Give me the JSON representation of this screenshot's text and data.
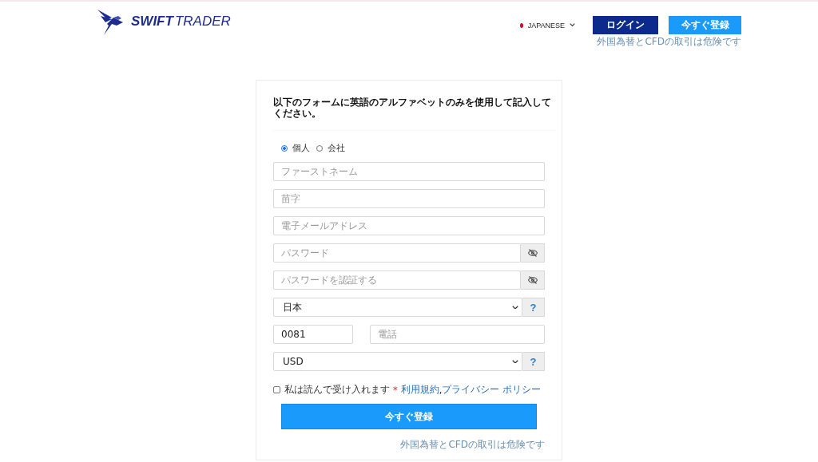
{
  "logo": {
    "word1": "SWIFT",
    "word2": "TRADER"
  },
  "header": {
    "language": "JAPANESE",
    "login": "ログイン",
    "register": "今すぐ登録",
    "risk_note": "外国為替とCFDの取引は危険です"
  },
  "form": {
    "heading": "以下のフォームに英語のアルファベットのみを使用して記入してください。",
    "account_types": [
      {
        "label": "個人",
        "selected": true
      },
      {
        "label": "会社",
        "selected": false
      }
    ],
    "fields": [
      {
        "kind": "text",
        "placeholder": "ファーストネーム"
      },
      {
        "kind": "text",
        "placeholder": "苗字"
      },
      {
        "kind": "text",
        "placeholder": "電子メールアドレス"
      },
      {
        "kind": "password",
        "placeholder": "パスワード"
      },
      {
        "kind": "password",
        "placeholder": "パスワードを認証する"
      },
      {
        "kind": "select",
        "value": "日本",
        "help": "?"
      },
      {
        "kind": "phone",
        "value": "0081",
        "placeholder": "電話"
      },
      {
        "kind": "select",
        "value": "USD",
        "help": "?"
      }
    ],
    "terms": {
      "checked": false,
      "text": "私は読んで受け入れます",
      "required_mark": "*",
      "links": [
        "利用規約",
        "プライバシー ポリシー"
      ],
      "separator": ","
    },
    "submit": "今すぐ登録",
    "risk_note": "外国為替とCFDの取引は危険です"
  }
}
